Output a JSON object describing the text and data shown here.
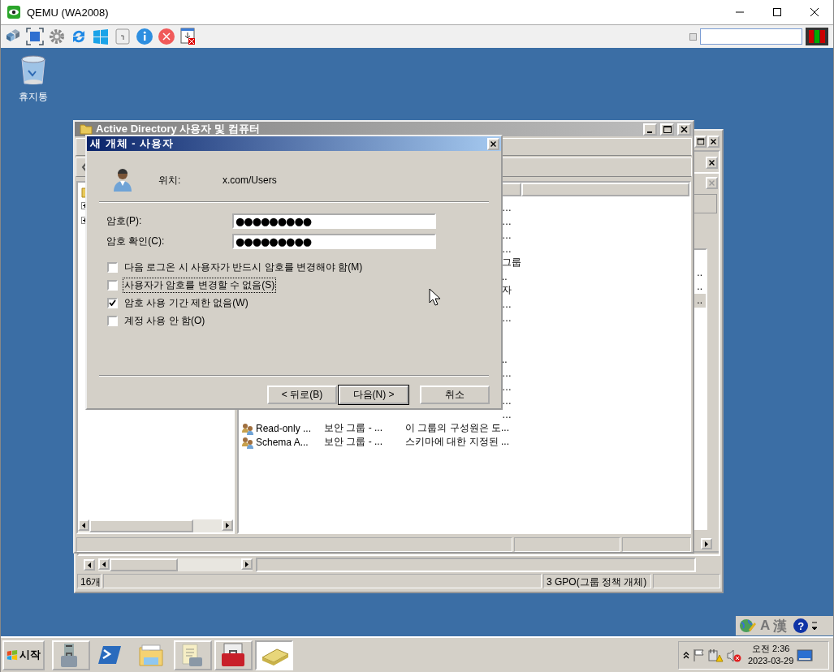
{
  "window": {
    "title": "QEMU (WA2008)"
  },
  "desktop": {
    "icons": [
      {
        "label": "휴지통"
      }
    ]
  },
  "back_window": {
    "side_list": [
      {
        "text": "..",
        "selected": false
      },
      {
        "text": "..",
        "selected": false
      },
      {
        "text": "..",
        "selected": true
      }
    ],
    "status_bar": {
      "count": "16개",
      "selection": "3 GPO(그룹 정책 개체)"
    }
  },
  "aduc_window": {
    "title": "Active Directory 사용자 및 컴퓨터",
    "rows": [
      {
        "kind": "covered",
        "tail": "…"
      },
      {
        "kind": "covered",
        "tail": "…"
      },
      {
        "kind": "covered",
        "tail": "…"
      },
      {
        "kind": "covered",
        "tail": "…"
      },
      {
        "kind": "covered",
        "tail": "그룹"
      },
      {
        "kind": "covered",
        "tail": ".."
      },
      {
        "kind": "covered",
        "tail": "자"
      },
      {
        "kind": "covered",
        "tail": "…"
      },
      {
        "kind": "covered",
        "tail": "…"
      },
      {
        "kind": "covered"
      },
      {
        "kind": "covered"
      },
      {
        "kind": "covered",
        "tail": ".."
      },
      {
        "kind": "covered",
        "tail": "…"
      },
      {
        "kind": "covered",
        "tail": "…"
      },
      {
        "kind": "covered",
        "tail": "…"
      },
      {
        "kind": "covered",
        "tail": "…"
      },
      {
        "kind": "full",
        "name": "Read-only ...",
        "type": "보안 그룹 - ...",
        "description": "이 그룹의 구성원은 도..."
      },
      {
        "kind": "full",
        "name": "Schema A...",
        "type": "보안 그룹 - ...",
        "description": "스키마에 대한 지정된 ..."
      }
    ]
  },
  "dialog": {
    "title": "새 개체 - 사용자",
    "location_label": "위치:",
    "location": "x.com/Users",
    "fields": [
      {
        "label": "암호(P):",
        "value": "●●●●●●●●●"
      },
      {
        "label": "암호 확인(C):",
        "value": "●●●●●●●●●"
      }
    ],
    "options": [
      {
        "label": "다음 로그온 시 사용자가 반드시 암호를 변경해야 함(M)",
        "checked": false,
        "focused": false
      },
      {
        "label": "사용자가 암호를 변경할 수 없음(S)",
        "checked": false,
        "focused": true
      },
      {
        "label": "암호 사용 기간 제한 없음(W)",
        "checked": true,
        "focused": false
      },
      {
        "label": "계정 사용 안 함(O)",
        "checked": false,
        "focused": false
      }
    ],
    "buttons": [
      {
        "label": "< 뒤로(B)",
        "default": false
      },
      {
        "label": "다음(N) >",
        "default": true
      },
      {
        "label": "취소",
        "default": false
      }
    ]
  },
  "language_bar": {
    "items": [
      "A",
      "漢"
    ],
    "help": "?"
  },
  "taskbar": {
    "start": "시작",
    "buttons": [
      {
        "framed": true,
        "selected": false
      },
      {
        "framed": false,
        "selected": false
      },
      {
        "framed": false,
        "selected": false
      },
      {
        "framed": true,
        "selected": false
      },
      {
        "framed": true,
        "selected": false
      },
      {
        "framed": true,
        "selected": true
      }
    ],
    "time": "오전 2:36",
    "date": "2023-03-29"
  }
}
